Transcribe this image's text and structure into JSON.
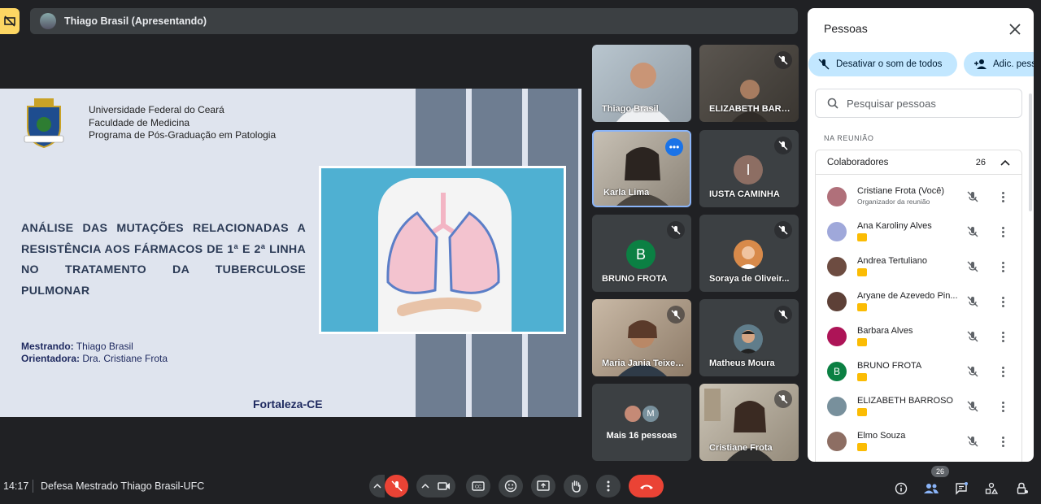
{
  "presenter_bar": {
    "label": "Thiago Brasil (Apresentando)"
  },
  "slide": {
    "institution": [
      "Universidade Federal do Ceará",
      "Faculdade de Medicina",
      "Programa de Pós-Graduação em Patologia"
    ],
    "title": "ANÁLISE DAS MUTAÇÕES RELACIONADAS A RESISTÊNCIA AOS FÁRMACOS DE 1ª E 2ª LINHA NO TRATAMENTO DA TUBERCULOSE PULMONAR",
    "student_label": "Mestrando:",
    "student_name": "Thiago Brasil",
    "advisor_label": "Orientadora:",
    "advisor_name": "Dra. Cristiane Frota",
    "city": "Fortaleza-CE"
  },
  "tiles": [
    {
      "name": "Thiago Brasil",
      "type": "video",
      "muted": false
    },
    {
      "name": "ELIZABETH BARR...",
      "type": "video",
      "muted": true
    },
    {
      "name": "Karla Lima",
      "type": "video",
      "muted": false,
      "active": true
    },
    {
      "name": "IUSTA CAMINHA",
      "type": "letter",
      "letter": "I",
      "color": "#8d6e63",
      "muted": true
    },
    {
      "name": "BRUNO FROTA",
      "type": "letter",
      "letter": "B",
      "color": "#0b8043",
      "muted": true
    },
    {
      "name": "Soraya de Oliveir...",
      "type": "avatar",
      "muted": true
    },
    {
      "name": "Maria Jania Teixei...",
      "type": "video",
      "muted": true
    },
    {
      "name": "Matheus Moura",
      "type": "avatar",
      "muted": true
    },
    {
      "name": "Mais 16 pessoas",
      "type": "more",
      "letter": "M"
    },
    {
      "name": "Cristiane Frota",
      "type": "video",
      "muted": true
    }
  ],
  "panel": {
    "title": "Pessoas",
    "mute_all": "Desativar o som de todos",
    "add_people": "Adic. pess",
    "search_placeholder": "Pesquisar pessoas",
    "section": "NA REUNIÃO",
    "group_name": "Colaboradores",
    "group_count": "26",
    "people": [
      {
        "name": "Cristiane Frota (Você)",
        "sub": "Organizador da reunião",
        "avatar_color": "#b0707a"
      },
      {
        "name": "Ana Karoliny Alves",
        "avatar_color": "#9fa8da"
      },
      {
        "name": "Andrea Tertuliano",
        "avatar_color": "#6d4c41"
      },
      {
        "name": "Aryane de Azevedo Pin...",
        "avatar_color": "#5d4037"
      },
      {
        "name": "Barbara Alves",
        "avatar_color": "#ad1457"
      },
      {
        "name": "BRUNO FROTA",
        "letter": "B",
        "avatar_color": "#0b8043"
      },
      {
        "name": "ELIZABETH BARROSO",
        "avatar_color": "#78909c"
      },
      {
        "name": "Elmo Souza",
        "avatar_color": "#8d6e63"
      }
    ]
  },
  "bottom": {
    "time": "14:17",
    "meeting_name": "Defesa Mestrado Thiago Brasil-UFC",
    "participants_badge": "26"
  },
  "colors": {
    "accent": "#8ab4f8",
    "end_call": "#ea4335",
    "present": "#fdd663",
    "chip": "#c2e7ff"
  }
}
